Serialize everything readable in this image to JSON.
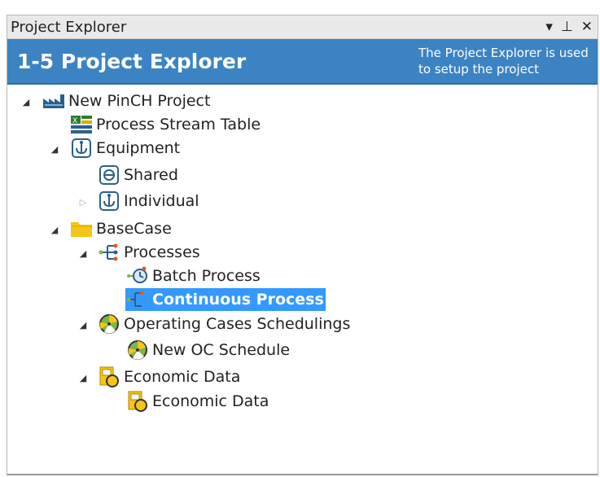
{
  "panel": {
    "title": "Project Explorer",
    "controls": {
      "dropdown": "▾",
      "pin": "⊥",
      "close": "✕"
    }
  },
  "banner": {
    "title": "1-5 Project Explorer",
    "description": "The Project Explorer is used to setup the project"
  },
  "tree": {
    "project": "New PinCH Project",
    "process_stream_table": "Process Stream Table",
    "equipment": "Equipment",
    "shared": "Shared",
    "individual": "Individual",
    "basecase": "BaseCase",
    "processes": "Processes",
    "batch_process": "Batch Process",
    "continuous_process": "Continuous Process",
    "operating_cases": "Operating Cases Schedulings",
    "new_oc_schedule": "New OC Schedule",
    "economic_data_folder": "Economic Data",
    "economic_data": "Economic Data"
  },
  "colors": {
    "banner": "#3c83c3",
    "selection": "#3399ff",
    "folder": "#f5c518"
  }
}
